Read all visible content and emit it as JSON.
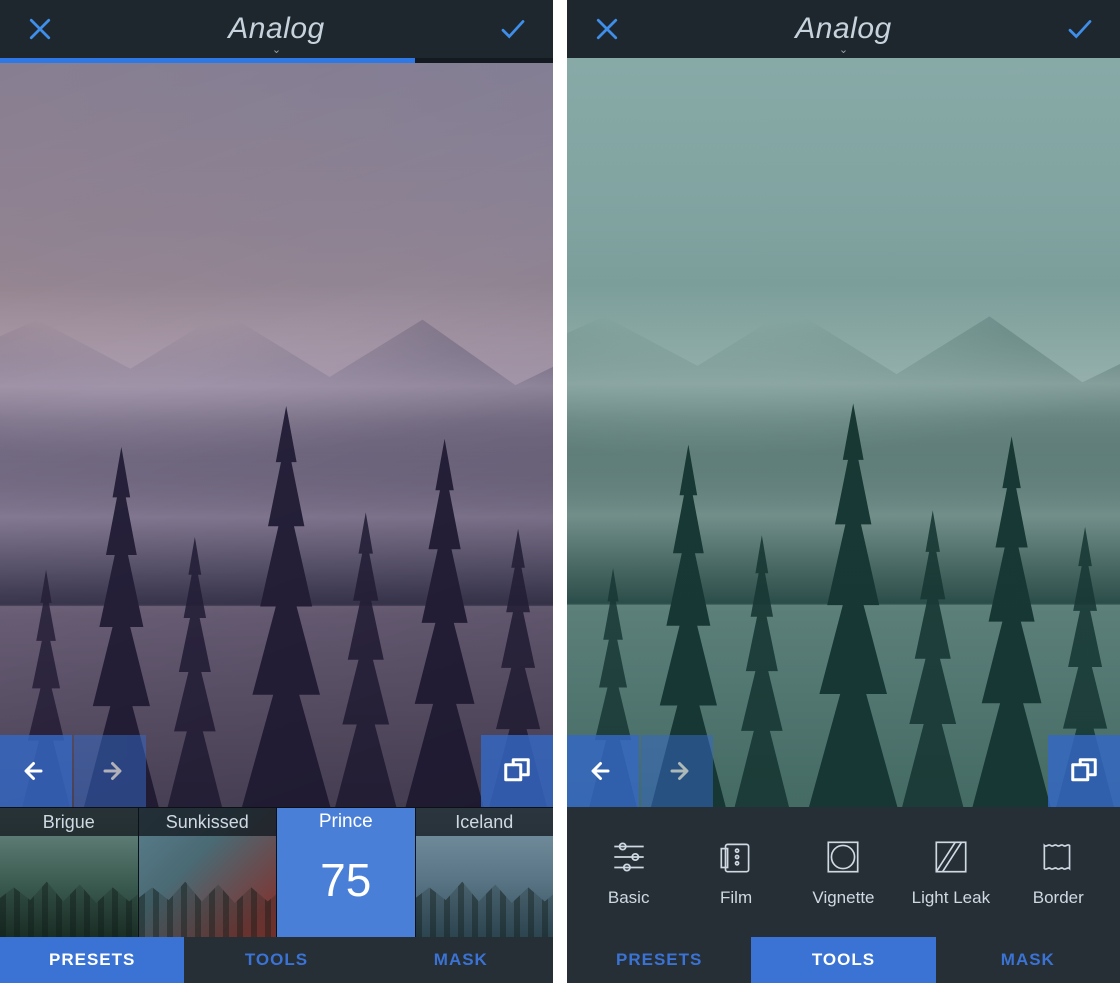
{
  "left": {
    "header": {
      "title": "Analog"
    },
    "slider_percent": 75,
    "presets": [
      {
        "name": "Brigue"
      },
      {
        "name": "Sunkissed"
      },
      {
        "name": "Prince",
        "value": "75",
        "selected": true
      },
      {
        "name": "Iceland"
      }
    ],
    "tabs": {
      "presets": "PRESETS",
      "tools": "TOOLS",
      "mask": "MASK",
      "active": "presets"
    }
  },
  "right": {
    "header": {
      "title": "Analog"
    },
    "tools": [
      {
        "name": "Basic"
      },
      {
        "name": "Film"
      },
      {
        "name": "Vignette"
      },
      {
        "name": "Light Leak"
      },
      {
        "name": "Border"
      }
    ],
    "tabs": {
      "presets": "PRESETS",
      "tools": "TOOLS",
      "mask": "MASK",
      "active": "tools"
    }
  }
}
